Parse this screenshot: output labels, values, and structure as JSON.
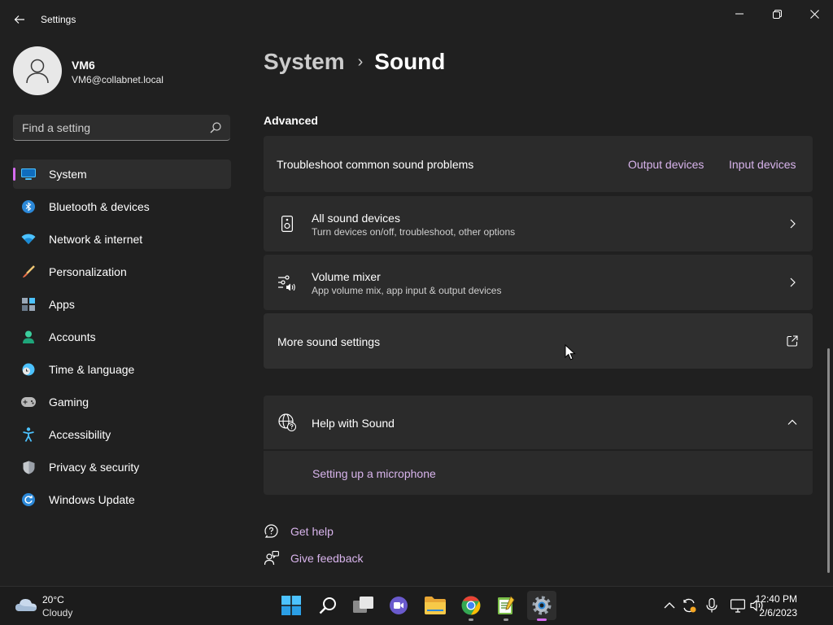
{
  "window": {
    "title": "Settings",
    "controls": [
      "minimize",
      "restore",
      "close"
    ]
  },
  "account": {
    "name": "VM6",
    "email": "VM6@collabnet.local"
  },
  "search": {
    "placeholder": "Find a setting"
  },
  "nav": {
    "items": [
      {
        "label": "System",
        "icon": "monitor-icon",
        "selected": true
      },
      {
        "label": "Bluetooth & devices",
        "icon": "bluetooth-icon"
      },
      {
        "label": "Network & internet",
        "icon": "wifi-icon"
      },
      {
        "label": "Personalization",
        "icon": "paintbrush-icon"
      },
      {
        "label": "Apps",
        "icon": "apps-icon"
      },
      {
        "label": "Accounts",
        "icon": "accounts-icon"
      },
      {
        "label": "Time & language",
        "icon": "clock-globe-icon"
      },
      {
        "label": "Gaming",
        "icon": "gamepad-icon"
      },
      {
        "label": "Accessibility",
        "icon": "accessibility-icon"
      },
      {
        "label": "Privacy & security",
        "icon": "shield-icon"
      },
      {
        "label": "Windows Update",
        "icon": "update-icon"
      }
    ]
  },
  "breadcrumb": {
    "parent": "System",
    "separator": "›",
    "current": "Sound"
  },
  "advanced": {
    "title": "Advanced",
    "troubleshoot": {
      "label": "Troubleshoot common sound problems",
      "links": [
        "Output devices",
        "Input devices"
      ]
    },
    "all_devices": {
      "title": "All sound devices",
      "subtitle": "Turn devices on/off, troubleshoot, other options"
    },
    "volume_mixer": {
      "title": "Volume mixer",
      "subtitle": "App volume mix, app input & output devices"
    },
    "more_settings": {
      "title": "More sound settings"
    }
  },
  "help": {
    "title": "Help with Sound",
    "links": [
      "Setting up a microphone"
    ]
  },
  "footer": {
    "get_help": "Get help",
    "give_feedback": "Give feedback"
  },
  "taskbar": {
    "weather": {
      "temp": "20°C",
      "condition": "Cloudy"
    },
    "apps": [
      "start-icon",
      "search-icon",
      "task-view-icon",
      "chat-icon",
      "file-explorer-icon",
      "chrome-icon",
      "notepad-icon",
      "settings-icon"
    ],
    "clock": {
      "time": "12:40 PM",
      "date": "2/6/2023"
    }
  },
  "colors": {
    "background": "#202020",
    "card": "#2b2b2b",
    "accent": "#d66cf0",
    "link": "#d8b4ec"
  }
}
